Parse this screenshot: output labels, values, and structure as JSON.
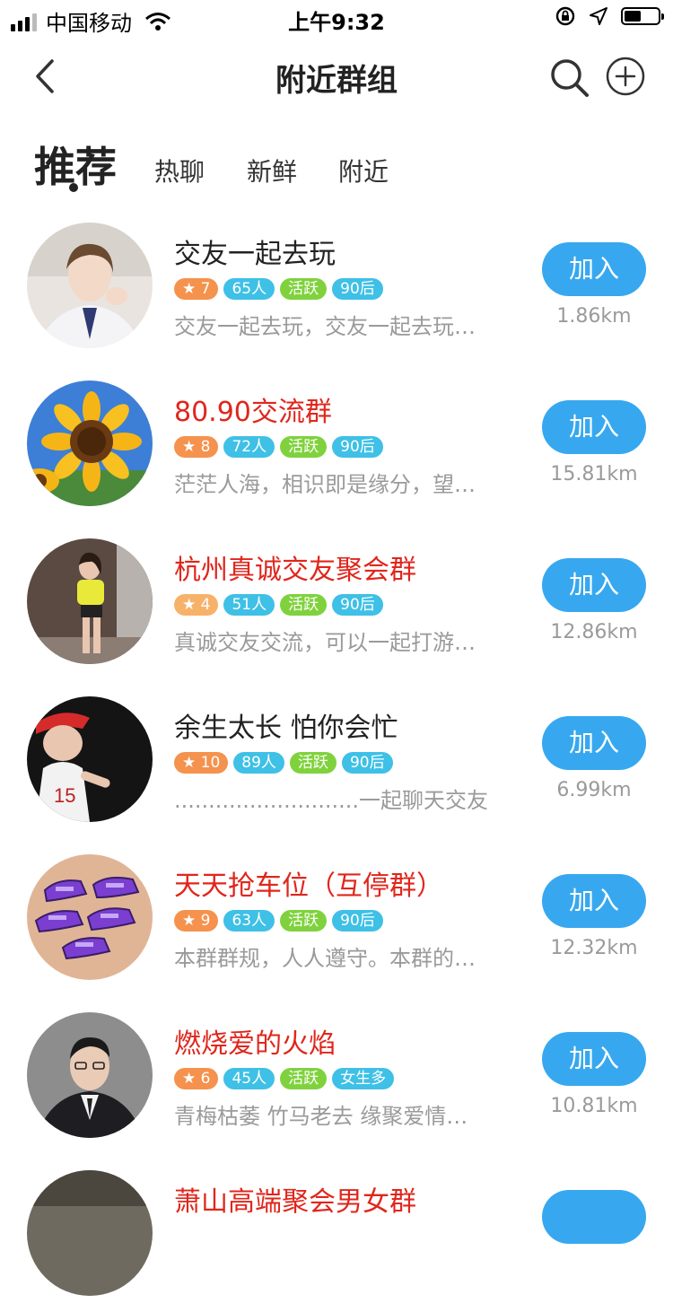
{
  "status_bar": {
    "carrier": "中国移动",
    "time": "上午9:32",
    "battery_level": 0.5
  },
  "nav": {
    "title": "附近群组"
  },
  "tabs": [
    {
      "label": "推荐",
      "active": true
    },
    {
      "label": "热聊",
      "active": false
    },
    {
      "label": "新鲜",
      "active": false
    },
    {
      "label": "附近",
      "active": false
    }
  ],
  "groups": [
    {
      "name": "交友一起去玩",
      "name_color": "normal",
      "level": "7",
      "members": "65人",
      "activity": "活跃",
      "age": "90后",
      "desc": "交友一起去玩，交友一起去玩…",
      "join": "加入",
      "distance": "1.86km"
    },
    {
      "name": "80.90交流群",
      "name_color": "red",
      "level": "8",
      "members": "72人",
      "activity": "活跃",
      "age": "90后",
      "desc": "茫茫人海，相识即是缘分，望…",
      "join": "加入",
      "distance": "15.81km"
    },
    {
      "name": "杭州真诚交友聚会群",
      "name_color": "red",
      "level": "4",
      "members": "51人",
      "activity": "活跃",
      "age": "90后",
      "desc": "真诚交友交流，可以一起打游…",
      "join": "加入",
      "distance": "12.86km"
    },
    {
      "name": "余生太长  怕你会忙",
      "name_color": "normal",
      "level": "10",
      "members": "89人",
      "activity": "活跃",
      "age": "90后",
      "desc": "...........................一起聊天交友",
      "join": "加入",
      "distance": "6.99km"
    },
    {
      "name": "天天抢车位（互停群）",
      "name_color": "red",
      "level": "9",
      "members": "63人",
      "activity": "活跃",
      "age": "90后",
      "desc": "本群群规，人人遵守。本群的…",
      "join": "加入",
      "distance": "12.32km"
    },
    {
      "name": "燃烧爱的火焰",
      "name_color": "red",
      "level": "6",
      "members": "45人",
      "activity": "活跃",
      "age": "女生多",
      "desc": "青梅枯萎  竹马老去  缘聚爱情…",
      "join": "加入",
      "distance": "10.81km"
    },
    {
      "name": "萧山高端聚会男女群",
      "name_color": "red",
      "level": "",
      "members": "",
      "activity": "",
      "age": "",
      "desc": "",
      "join": "",
      "distance": ""
    }
  ],
  "icons": {
    "back": "chevron-left-icon",
    "search": "search-icon",
    "add": "plus-circle-icon",
    "level": "star-icon",
    "wifi": "wifi-icon",
    "location": "location-arrow-icon",
    "lock": "rotation-lock-icon"
  },
  "colors": {
    "accent": "#37a8ef",
    "red_name": "#e0261c",
    "tag_blue": "#3fc0e6",
    "tag_green": "#7fd23d",
    "tag_orange": "#f5924d"
  }
}
